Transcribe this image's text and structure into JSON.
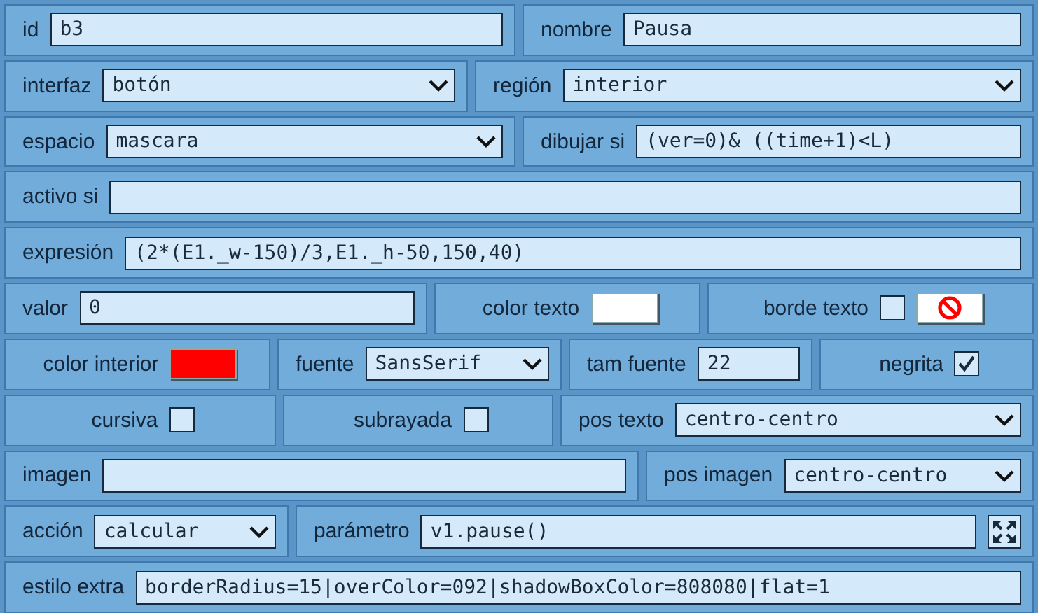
{
  "rows": [
    {
      "cells": [
        {
          "label": "id",
          "kind": "text",
          "value": "b3"
        },
        {
          "label": "nombre",
          "kind": "text",
          "value": "Pausa"
        }
      ]
    },
    {
      "cells": [
        {
          "label": "interfaz",
          "kind": "select",
          "value": "botón"
        },
        {
          "label": "región",
          "kind": "select",
          "value": "interior"
        }
      ]
    },
    {
      "cells": [
        {
          "label": "espacio",
          "kind": "select",
          "value": "mascara"
        },
        {
          "label": "dibujar si",
          "kind": "text",
          "value": "(ver=0)& ((time+1)<L)"
        }
      ]
    },
    {
      "cells": [
        {
          "label": "activo si",
          "kind": "text"
        }
      ]
    },
    {
      "cells": [
        {
          "label": "expresión",
          "kind": "text",
          "value": "(2*(E1._w-150)/3,E1._h-50,150,40)"
        }
      ]
    },
    {
      "cells": [
        {
          "label": "valor",
          "kind": "text",
          "value": "0"
        },
        {
          "label": "color texto",
          "kind": "color",
          "color": "#ffffff"
        },
        {
          "label": "borde texto",
          "kind": "checkbox-nocolor",
          "checked": false
        }
      ]
    },
    {
      "cells": [
        {
          "label": "color interior",
          "kind": "color",
          "color": "#ff0000"
        },
        {
          "label": "fuente",
          "kind": "select",
          "value": "SansSerif"
        },
        {
          "label": "tam fuente",
          "kind": "text",
          "value": "22"
        },
        {
          "label": "negrita",
          "kind": "checkbox",
          "checked": true
        }
      ]
    },
    {
      "cells": [
        {
          "label": "cursiva",
          "kind": "checkbox",
          "checked": false
        },
        {
          "label": "subrayada",
          "kind": "checkbox",
          "checked": false
        },
        {
          "label": "pos texto",
          "kind": "select",
          "value": "centro-centro"
        }
      ]
    },
    {
      "cells": [
        {
          "label": "imagen",
          "kind": "text"
        },
        {
          "label": "pos imagen",
          "kind": "select",
          "value": "centro-centro"
        }
      ]
    },
    {
      "cells": [
        {
          "label": "acción",
          "kind": "select",
          "value": "calcular"
        },
        {
          "label": "parámetro",
          "kind": "text-expand",
          "value": "v1.pause()"
        }
      ]
    },
    {
      "cells": [
        {
          "label": "estilo extra",
          "kind": "text",
          "value": "borderRadius=15|overColor=092|shadowBoxColor=808080|flat=1"
        }
      ]
    }
  ]
}
